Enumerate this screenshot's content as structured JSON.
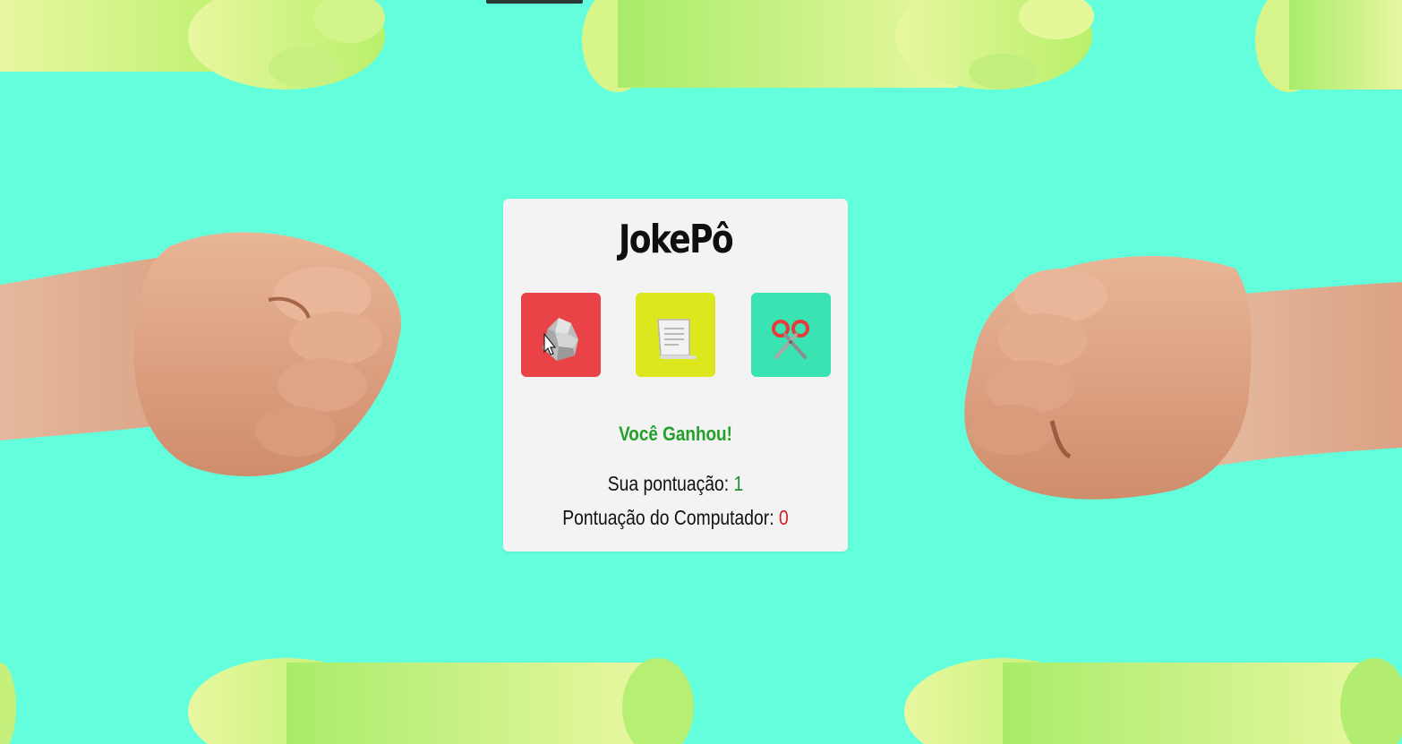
{
  "game": {
    "title": "JokePô",
    "result": "Você Ganhou!",
    "user_score_label": "Sua pontuação: ",
    "user_score": "1",
    "computer_score_label": "Pontuação do Computador: ",
    "computer_score": "0"
  },
  "choices": [
    {
      "name": "rock",
      "icon": "rock-icon",
      "color": "#e94348"
    },
    {
      "name": "paper",
      "icon": "paper-icon",
      "color": "#dde71d"
    },
    {
      "name": "scissors",
      "icon": "scissors-icon",
      "color": "#3ae3b2"
    }
  ],
  "colors": {
    "background": "#63fedc",
    "card": "#f3f3f3",
    "win_text": "#22a02a",
    "user_score": "#2a8a33",
    "computer_score": "#d21c26"
  }
}
